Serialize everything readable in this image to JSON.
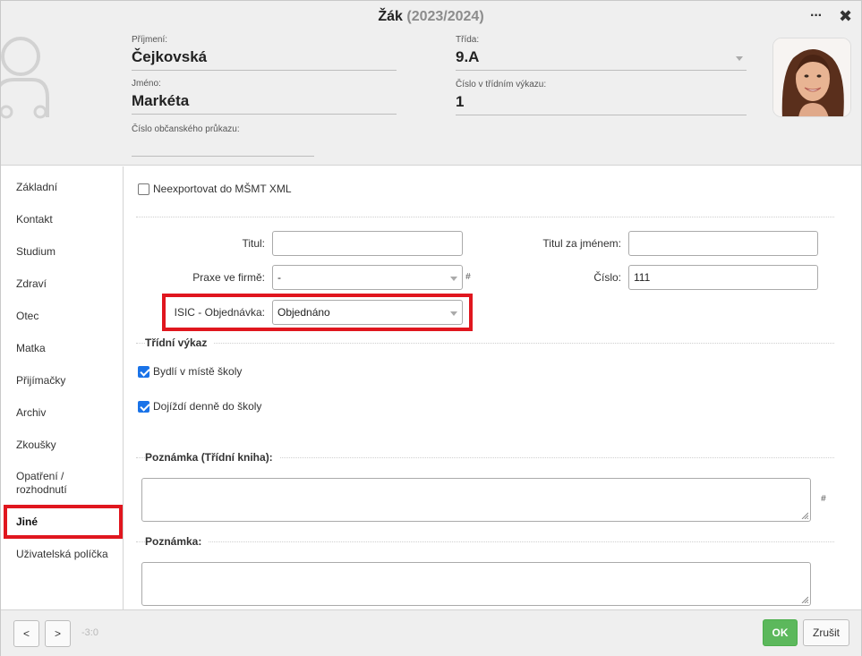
{
  "header": {
    "title": "Žák",
    "year": "(2023/2024)",
    "more_label": "···",
    "close_label": "✖",
    "surname": {
      "label": "Příjmení:",
      "value": "Čejkovská"
    },
    "firstname": {
      "label": "Jméno:",
      "value": "Markéta"
    },
    "idcard": {
      "label": "Číslo občanského průkazu:",
      "value": ""
    },
    "class": {
      "label": "Třída:",
      "value": "9.A"
    },
    "register_no": {
      "label": "Číslo v třídním výkazu:",
      "value": "1"
    }
  },
  "sidebar": {
    "items": [
      {
        "label": "Základní"
      },
      {
        "label": "Kontakt"
      },
      {
        "label": "Studium"
      },
      {
        "label": "Zdraví"
      },
      {
        "label": "Otec"
      },
      {
        "label": "Matka"
      },
      {
        "label": "Přijímačky"
      },
      {
        "label": "Archiv"
      },
      {
        "label": "Zkoušky"
      },
      {
        "label": "Opatření /"
      },
      {
        "label": "rozhodnutí"
      },
      {
        "label": "Jiné"
      },
      {
        "label": "Uživatelská políčka"
      }
    ],
    "active": "Jiné"
  },
  "content": {
    "no_export": {
      "label": "Neexportovat do MŠMT XML",
      "checked": false
    },
    "titul": {
      "label": "Titul:",
      "value": ""
    },
    "titul_after": {
      "label": "Titul za jménem:",
      "value": ""
    },
    "praxe": {
      "label": "Praxe ve firmě:",
      "value": "-"
    },
    "cislo": {
      "label": "Číslo:",
      "value": "111"
    },
    "isic": {
      "label": "ISIC - Objednávka:",
      "value": "Objednáno"
    },
    "hash_symbol": "#",
    "class_register": {
      "title": "Třídní výkaz",
      "lives_in_school_town": {
        "label": "Bydlí v místě školy",
        "checked": true
      },
      "commutes_daily": {
        "label": "Dojíždí denně do školy",
        "checked": true
      }
    },
    "note_class_book": {
      "title": "Poznámka (Třídní kniha):",
      "value": ""
    },
    "note": {
      "title": "Poznámka:",
      "value": ""
    }
  },
  "footer": {
    "prev_label": "<",
    "next_label": ">",
    "version": "-3:0",
    "ok_label": "OK",
    "cancel_label": "Zrušit"
  },
  "colors": {
    "highlight": "#e0161e",
    "ok_green": "#5cb85c",
    "checkbox_blue": "#1a73e8"
  },
  "icons": [
    "user-placeholder-icon",
    "more-icon",
    "close-icon",
    "chevron-down-icon",
    "hash-icon",
    "resize-grip-icon"
  ]
}
